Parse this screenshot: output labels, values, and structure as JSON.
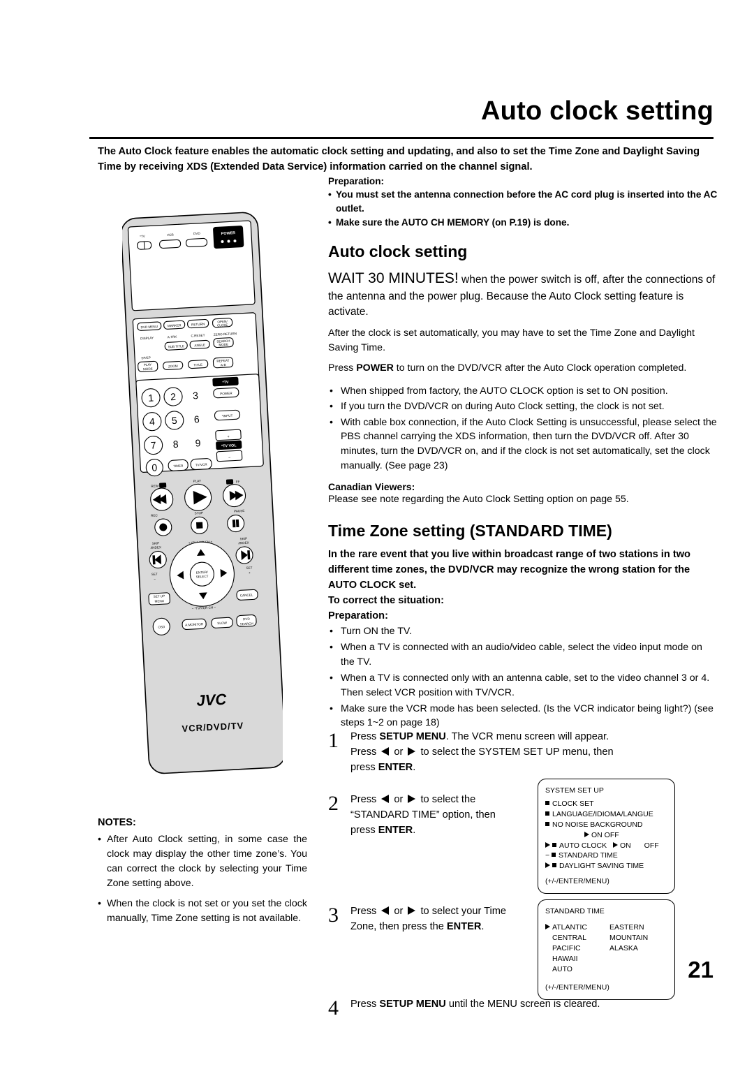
{
  "header": {
    "title": "Auto clock setting",
    "intro": "The Auto Clock feature enables the automatic clock setting and updating, and also to set the Time Zone and Daylight Saving Time by receiving XDS (Extended Data Service) information carried on the channel signal."
  },
  "preparation": {
    "heading": "Preparation:",
    "items": [
      "You must set the antenna connection before the AC cord plug is inserted into the AC outlet.",
      "Make sure the AUTO CH MEMORY (on P.19) is done."
    ]
  },
  "auto_clock": {
    "heading": "Auto clock setting",
    "wait_big": "WAIT 30 MINUTES!",
    "wait_rest": " when the power switch is off, after the connections of the antenna and the power plug. Because the Auto Clock setting feature is activate.",
    "para2": "After the clock is set automatically, you may have to set the Time Zone and Daylight Saving Time.",
    "para3_pre": "Press ",
    "para3_bold": "POWER",
    "para3_post": " to turn on the DVD/VCR after the Auto Clock operation completed.",
    "bullets": [
      "When shipped from factory, the AUTO CLOCK option is set to ON position.",
      "If you turn the DVD/VCR on during Auto Clock setting, the clock is not set.",
      "With cable box connection, if the Auto Clock Setting is unsuccessful, please select the PBS channel carrying the XDS information, then turn the DVD/VCR off. After 30 minutes, turn the DVD/VCR on, and if the clock is not set automatically, set the clock manually. (See page 23)"
    ],
    "canadian_heading": "Canadian Viewers:",
    "canadian_text": "Please see note regarding the Auto Clock Setting option on page 55."
  },
  "time_zone": {
    "heading": "Time Zone setting (STANDARD TIME)",
    "bold_para": "In the rare event that you live within broadcast range of two stations in two different time zones, the DVD/VCR may recognize the wrong station for the AUTO CLOCK set.",
    "correct": "To correct the situation:",
    "prep_heading": "Preparation:",
    "prep_items": [
      "Turn ON the TV.",
      "When a TV is connected with an audio/video cable, select the video input mode on the TV.",
      "When a TV is connected only with an antenna cable, set to the video channel 3 or 4. Then select VCR position with TV/VCR.",
      "Make sure the VCR mode has been selected. (Is the VCR indicator being light?) (see steps 1~2 on page 18)"
    ]
  },
  "steps": [
    {
      "num": "1",
      "line1_pre": "Press ",
      "line1_bold": "SETUP MENU",
      "line1_post": ". The VCR menu screen will appear.",
      "line2_pre": "Press ",
      "line2_mid": " or ",
      "line2_post": " to select the SYSTEM SET UP menu, then",
      "line3_pre": "press ",
      "line3_bold": "ENTER",
      "line3_post": "."
    },
    {
      "num": "2",
      "line1_pre": "Press ",
      "line1_mid": " or ",
      "line1_post": " to select the",
      "line2": "“STANDARD TIME” option, then",
      "line3_pre": "press ",
      "line3_bold": "ENTER",
      "line3_post": "."
    },
    {
      "num": "3",
      "line1_pre": "Press ",
      "line1_mid": " or ",
      "line1_post": " to select your Time",
      "line2_pre": "Zone, then press the ",
      "line2_bold": "ENTER",
      "line2_post": "."
    },
    {
      "num": "4",
      "line1_pre": "Press ",
      "line1_bold": "SETUP MENU",
      "line1_post": " until the MENU screen is cleared."
    }
  ],
  "osd_system": {
    "title": "SYSTEM SET UP",
    "items": [
      "CLOCK SET",
      "LANGUAGE/IDIOMA/LANGUE",
      "NO NOISE BACKGROUND"
    ],
    "on_off_row": "ON      OFF",
    "auto_clock_label": "AUTO CLOCK",
    "auto_clock_on": "ON",
    "auto_clock_off": "OFF",
    "standard_time": "STANDARD TIME",
    "daylight": "DAYLIGHT SAVING TIME",
    "footer": "(+/-/ENTER/MENU)"
  },
  "osd_standard": {
    "title": "STANDARD TIME",
    "col1": [
      "ATLANTIC",
      "CENTRAL",
      "PACIFIC",
      "HAWAII",
      "AUTO"
    ],
    "col2": [
      "EASTERN",
      "MOUNTAIN",
      "ALASKA"
    ],
    "footer": "(+/-/ENTER/MENU)"
  },
  "notes": {
    "heading": "NOTES:",
    "items": [
      "After Auto Clock setting, in some case the clock may display the other time zone’s. You can correct the clock by selecting your Time Zone setting above.",
      "When the clock is not set or you set the clock manually, Time Zone setting is not available."
    ]
  },
  "page_number": "21",
  "remote": {
    "brand": "JVC",
    "model": "VCR/DVD/TV",
    "top_labels": [
      "*TV",
      "VCR",
      "DVD"
    ],
    "power": "POWER",
    "function_keys": [
      "DVD MENU",
      "MARKER",
      "RETURN",
      "OPEN/CLOSE",
      "DISPLAY",
      "A.TRK",
      "C.RESET",
      "ZERO RETURN",
      "SUB TITLE",
      "ANGLE",
      "SEARCH MODE",
      "SP/EP",
      "PLAY MODE",
      "ZOOM",
      "TITLE",
      "REPEAT A-B"
    ],
    "numbers": [
      "1",
      "2",
      "3",
      "4",
      "5",
      "6",
      "7",
      "8",
      "9",
      "0"
    ],
    "tv_block": [
      "*TV",
      "POWER",
      "*INPUT",
      "*TV VOL"
    ],
    "timer": "TIMER",
    "tvvcr": "TV/VCR",
    "transport": [
      "REW",
      "PLAY",
      "FF",
      "REC",
      "STOP",
      "PAUSE"
    ],
    "skip_left": "SKIP /INDEX",
    "skip_right": "SKIP /INDEX",
    "ch_up": "*TV/VCR CH +",
    "ch_down": "*TV/VCR CH −",
    "enter": "ENTER/ SELECT",
    "set_left": "SET −",
    "set_right": "SET +",
    "setup_menu": "SET UP MENU",
    "cancel": "CANCEL",
    "osd": "OSD",
    "monitor": "A.MONITOR",
    "slow": "SLOW",
    "dvd_search": "DVD SEARCH"
  }
}
